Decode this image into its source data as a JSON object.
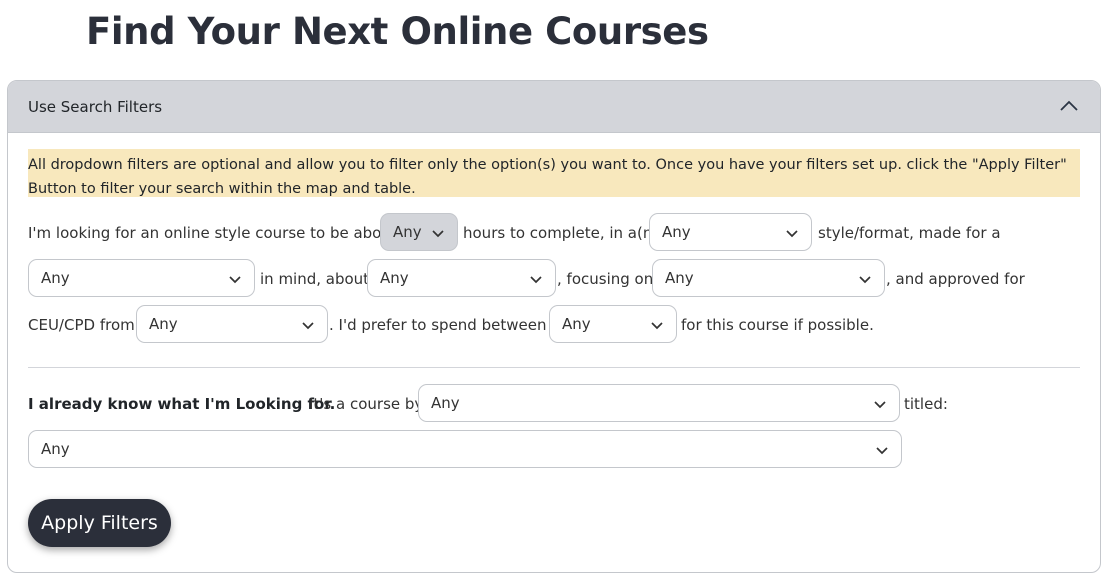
{
  "page": {
    "title": "Find Your Next Online Courses"
  },
  "accordion": {
    "title": "Use Search Filters",
    "expanded": true
  },
  "note": "All dropdown filters are optional and allow you to filter only the option(s) you want to. Once you have your filters set up. click the \"Apply Filter\" Button to filter your search within the map and table.",
  "sentence": {
    "t1": "I'm looking for an online style course to be about",
    "t2": "hours to complete, in a(n)",
    "t3": "style/format, made for a",
    "t4": "in mind, about",
    "t5": ", focusing on",
    "t6": ", and approved for",
    "t7": "CEU/CPD from",
    "t8": ". I'd prefer to spend between $",
    "t9": "for this course if possible."
  },
  "filters": {
    "hours": "Any",
    "style": "Any",
    "audience": "Any",
    "topic": "Any",
    "focus": "Any",
    "ceu": "Any",
    "price": "Any"
  },
  "known": {
    "bold": "I already know what I'm Looking for.",
    "t1": "It's a course by",
    "t2": "titled:",
    "provider": "Any",
    "title": "Any"
  },
  "apply_label": "Apply Filters",
  "colors": {
    "accent": "#2b2f3a",
    "note_bg": "#f8e8bd",
    "header_bg": "#d3d5da"
  }
}
